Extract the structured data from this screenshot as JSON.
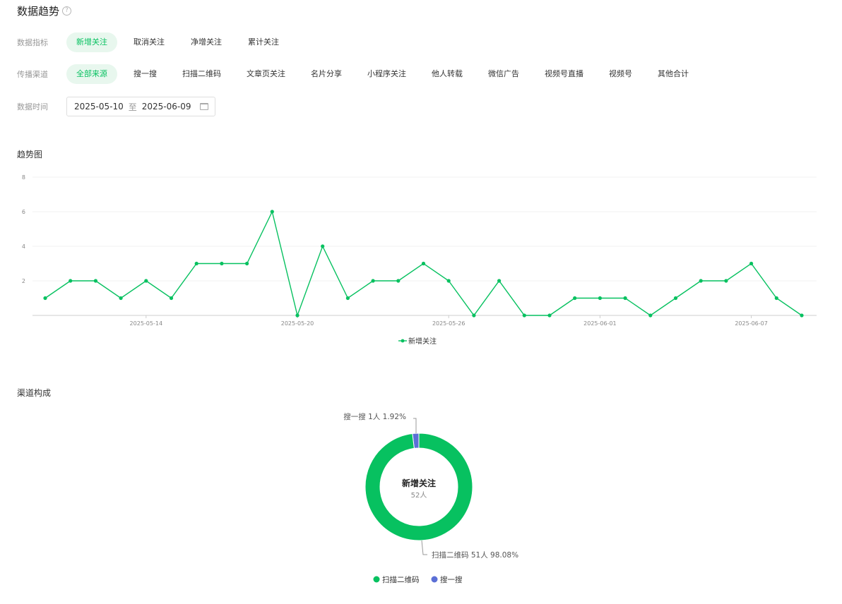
{
  "header": {
    "title": "数据趋势",
    "help_icon": "?"
  },
  "filters": {
    "metric": {
      "label": "数据指标",
      "options": [
        "新增关注",
        "取消关注",
        "净增关注",
        "累计关注"
      ],
      "selected": 0
    },
    "channel": {
      "label": "传播渠道",
      "options": [
        "全部来源",
        "搜一搜",
        "扫描二维码",
        "文章页关注",
        "名片分享",
        "小程序关注",
        "他人转载",
        "微信广告",
        "视频号直播",
        "视频号",
        "其他合计"
      ],
      "selected": 0
    },
    "date": {
      "label": "数据时间",
      "start": "2025-05-10",
      "separator": "至",
      "end": "2025-06-09"
    }
  },
  "trend": {
    "title": "趋势图"
  },
  "composition": {
    "title": "渠道构成"
  },
  "colors": {
    "accent": "#07c160",
    "secondary": "#5b6fd6"
  },
  "chart_data": [
    {
      "type": "line",
      "ylim": [
        0,
        8
      ],
      "yticks": [
        "2",
        "4",
        "6",
        "8"
      ],
      "xticks": [
        "2025-05-14",
        "2025-05-20",
        "2025-05-26",
        "2025-06-01",
        "2025-06-07"
      ],
      "grid": true,
      "legend_position": "bottom",
      "series": [
        {
          "name": "新增关注",
          "color": "#07c160",
          "values": [
            1,
            2,
            2,
            1,
            2,
            1,
            3,
            3,
            3,
            6,
            0,
            4,
            1,
            2,
            2,
            3,
            2,
            0,
            2,
            0,
            0,
            1,
            1,
            1,
            0,
            1,
            2,
            2,
            3,
            1,
            0
          ]
        }
      ]
    },
    {
      "type": "pie",
      "center_title": "新增关注",
      "center_value": "52人",
      "legend_position": "bottom",
      "slices": [
        {
          "name": "扫描二维码",
          "count": "51人",
          "percent": "98.08%",
          "value": 51,
          "color": "#07c160"
        },
        {
          "name": "搜一搜",
          "count": "1人",
          "percent": "1.92%",
          "value": 1,
          "color": "#5b6fd6"
        }
      ]
    }
  ]
}
